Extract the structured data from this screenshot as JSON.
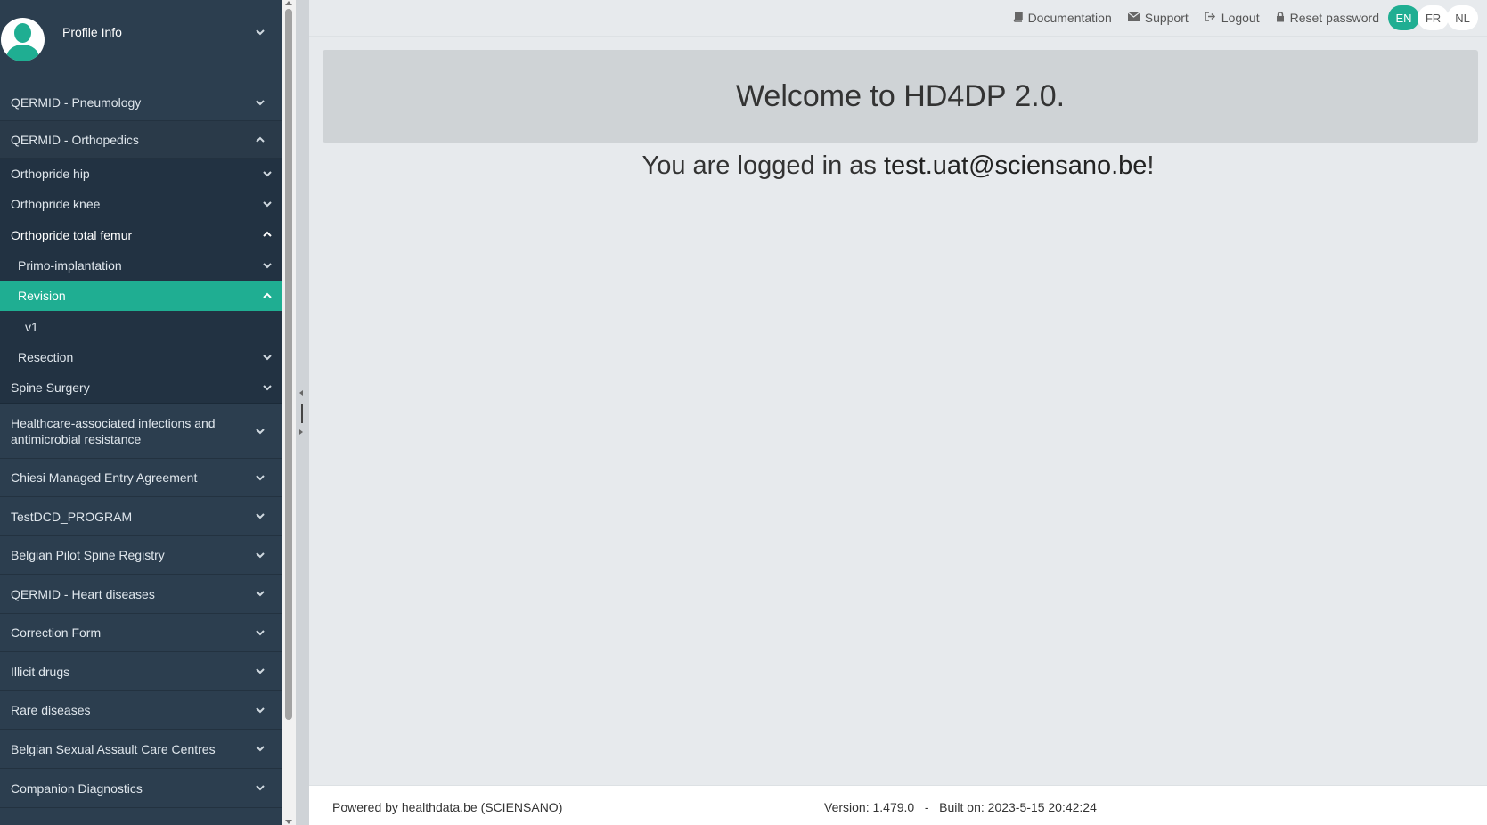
{
  "profile": {
    "label": "Profile Info"
  },
  "sidebar": {
    "sections": [
      {
        "label": "QERMID - Pneumology"
      },
      {
        "label": "QERMID - Orthopedics"
      }
    ],
    "orthopedics_sub": [
      {
        "label": "Orthopride hip"
      },
      {
        "label": "Orthopride knee"
      },
      {
        "label": "Orthopride total femur"
      }
    ],
    "femur_sub": [
      {
        "label": "Primo-implantation"
      },
      {
        "label": "Revision"
      },
      {
        "label": "v1"
      },
      {
        "label": "Resection"
      }
    ],
    "spine": {
      "label": "Spine Surgery"
    },
    "programs": [
      {
        "label": "Healthcare-associated infections and antimicrobial resistance"
      },
      {
        "label": "Chiesi Managed Entry Agreement"
      },
      {
        "label": "TestDCD_PROGRAM"
      },
      {
        "label": "Belgian Pilot Spine Registry"
      },
      {
        "label": "QERMID - Heart diseases"
      },
      {
        "label": "Correction Form"
      },
      {
        "label": "Illicit drugs"
      },
      {
        "label": "Rare diseases"
      },
      {
        "label": "Belgian Sexual Assault Care Centres"
      },
      {
        "label": "Companion Diagnostics"
      }
    ]
  },
  "topbar": {
    "documentation": "Documentation",
    "support": "Support",
    "logout": "Logout",
    "reset_password": "Reset password",
    "languages": [
      "EN",
      "FR",
      "NL"
    ],
    "active_language": "EN"
  },
  "main": {
    "welcome": "Welcome to HD4DP 2.0.",
    "logged_prefix": "You are logged in as ",
    "email": "test.uat@sciensano.be",
    "logged_suffix": "!"
  },
  "footer": {
    "powered_by": "Powered by healthdata.be (SCIENSANO)",
    "version": "Version: 1.479.0   -   Built on: 2023-5-15 20:42:24"
  },
  "colors": {
    "sidebar": "#2c3e4f",
    "accent": "#1fae92",
    "background": "#e7eaed"
  }
}
